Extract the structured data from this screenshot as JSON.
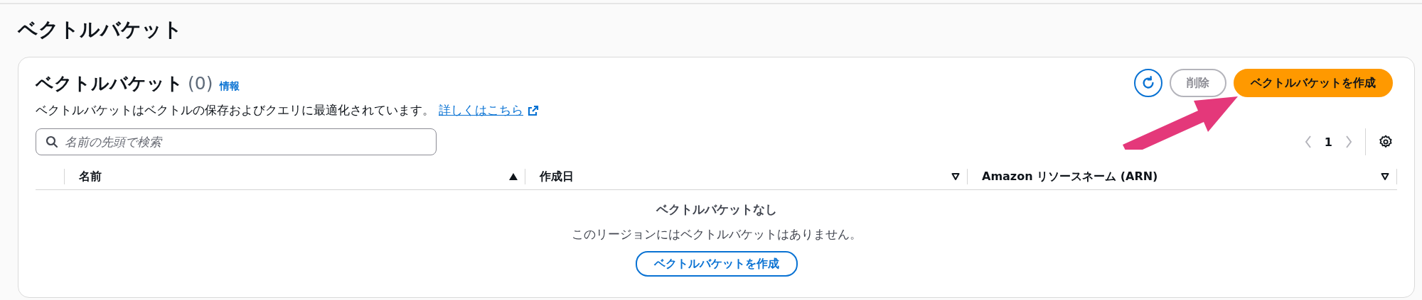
{
  "page_title": "ベクトルバケット",
  "panel": {
    "title": "ベクトルバケット",
    "count": "(0)",
    "info_link": "情報",
    "description": "ベクトルバケットはベクトルの保存およびクエリに最適化されています。",
    "learn_more_link": "詳しくはこちら",
    "actions": [
      {
        "kind": "refresh"
      },
      {
        "kind": "normal",
        "label": "削除",
        "disabled": true
      },
      {
        "kind": "primary",
        "label": "ベクトルバケットを作成",
        "disabled": false
      }
    ],
    "search": {
      "placeholder": "名前の先頭で検索"
    },
    "pagination": {
      "page": "1"
    },
    "table": {
      "columns": [
        {
          "label": "名前",
          "sorted": true
        },
        {
          "label": "作成日",
          "sorted": false
        },
        {
          "label": "Amazon リソースネーム (ARN)",
          "sorted": false
        }
      ],
      "empty_state": {
        "title": "ベクトルバケットなし",
        "message": "このリージョンにはベクトルバケットはありません。",
        "button": "ベクトルバケットを作成"
      }
    }
  }
}
